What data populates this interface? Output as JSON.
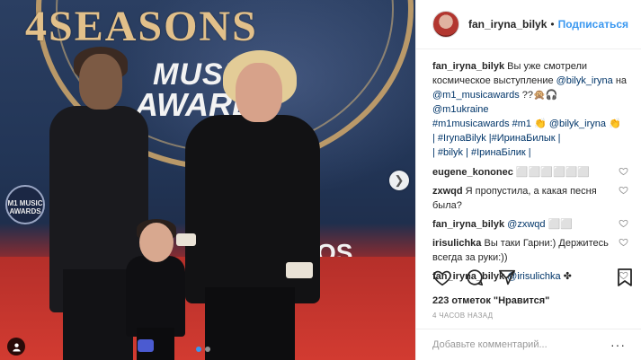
{
  "photo": {
    "brand_top": "4SEASONS",
    "brand_music": "MUSIC",
    "brand_awards": "AWARDS",
    "brand_small": "M1 MUSIC AWARDS",
    "brand_os": "OS",
    "next_icon": "chevron-right-icon",
    "tag_icon": "user-tag-icon",
    "carousel": {
      "count": 2,
      "active": 1
    }
  },
  "header": {
    "avatar_icon": "avatar",
    "username": "fan_iryna_bilyk",
    "separator": "•",
    "follow_label": "Подписаться"
  },
  "caption": {
    "user": "fan_iryna_bilyk",
    "text_1": " Вы уже смотрели космическое выступление ",
    "mention_1": "@bilyk_iryna",
    "text_2": " на ",
    "mention_2": "@m1_musicawards",
    "text_3": " ??🙊🎧",
    "mention_3": "@m1ukraine",
    "tag_1": "#m1musicawards",
    "tag_2": " #m1",
    "text_4": " 👏 ",
    "mention_4": "@bilyk_iryna",
    "text_5": " 👏",
    "line_2": "| #IrynaBilyk |#ИринаБилык |",
    "line_3": "| #bilyk | #ІринаБілик |"
  },
  "comments": [
    {
      "user": "eugene_kononec",
      "text": " ⬜⬜⬜⬜⬜⬜",
      "mention": ""
    },
    {
      "user": "zxwqd",
      "text": " Я пропустила, а какая песня была?",
      "mention": ""
    },
    {
      "user": "fan_iryna_bilyk",
      "text": " ⬜⬜",
      "mention": "@zxwqd"
    },
    {
      "user": "irisulichka",
      "text": " Вы таки Гарни:) Держитесь всегда за руки:))",
      "mention": ""
    },
    {
      "user": "fan_iryna_bilyk",
      "text": " ✤",
      "mention": "@irisulichka"
    }
  ],
  "actions": {
    "like_icon": "heart-icon",
    "comment_icon": "comment-icon",
    "share_icon": "share-icon",
    "save_icon": "bookmark-icon"
  },
  "likes_text": "223 отметок \"Нравится\"",
  "time_text": "4 часов назад",
  "comment_input": {
    "placeholder": "Добавьте комментарий...",
    "value": ""
  },
  "more_label": "···",
  "colors": {
    "link": "#003569",
    "accent": "#3897f0",
    "muted": "#999999",
    "text": "#262626"
  }
}
